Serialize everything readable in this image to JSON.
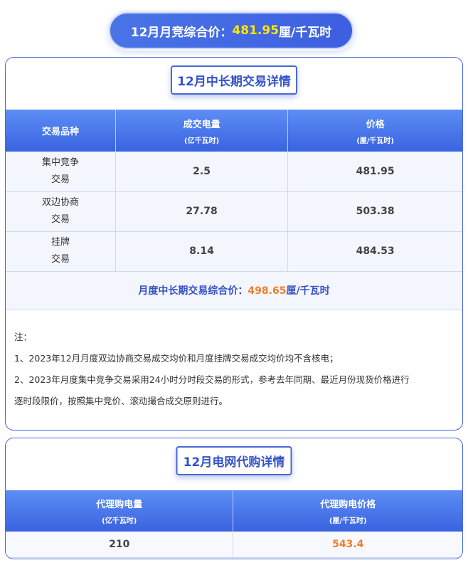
{
  "header": {
    "label": "12月月竞综合价：",
    "price": "481.95",
    "unit": "厘/千瓦时"
  },
  "section1": {
    "title": "12月中长期交易详情",
    "columns": [
      {
        "label": "交易品种",
        "sub": ""
      },
      {
        "label": "成交电量",
        "sub": "(亿千瓦时)"
      },
      {
        "label": "价格",
        "sub": "(厘/千瓦时)"
      }
    ],
    "rows": [
      {
        "name_line1": "集中竞争",
        "name_line2": "交易",
        "volume": "2.5",
        "price": "481.95"
      },
      {
        "name_line1": "双边协商",
        "name_line2": "交易",
        "volume": "27.78",
        "price": "503.38"
      },
      {
        "name_line1": "挂牌",
        "name_line2": "交易",
        "volume": "8.14",
        "price": "484.53"
      }
    ],
    "summary": {
      "label": "月度中长期交易综合价：",
      "price": "498.65",
      "unit": "厘/千瓦时"
    },
    "notes": {
      "heading": "注：",
      "line1": "1、2023年12月月度双边协商交易成交均价和月度挂牌交易成交均价均不含核电；",
      "line2a": "2、2023年月度集中竞争交易采用24小时分时段交易的形式，参考去年同期、最近月份现货价格进行",
      "line2b": "逐时段限价，按照集中竞价、滚动撮合成交原则进行。"
    }
  },
  "section2": {
    "title": "12月电网代购详情",
    "columns": [
      {
        "label": "代理购电量",
        "sub": "(亿千瓦时)"
      },
      {
        "label": "代理购电价格",
        "sub": "(厘/千瓦时)"
      }
    ],
    "row": {
      "volume": "210",
      "price": "543.4"
    }
  },
  "colors": {
    "primary_blue": "#3d5fe0",
    "highlight_yellow": "#ffe600",
    "accent_orange": "#f07d2e"
  }
}
